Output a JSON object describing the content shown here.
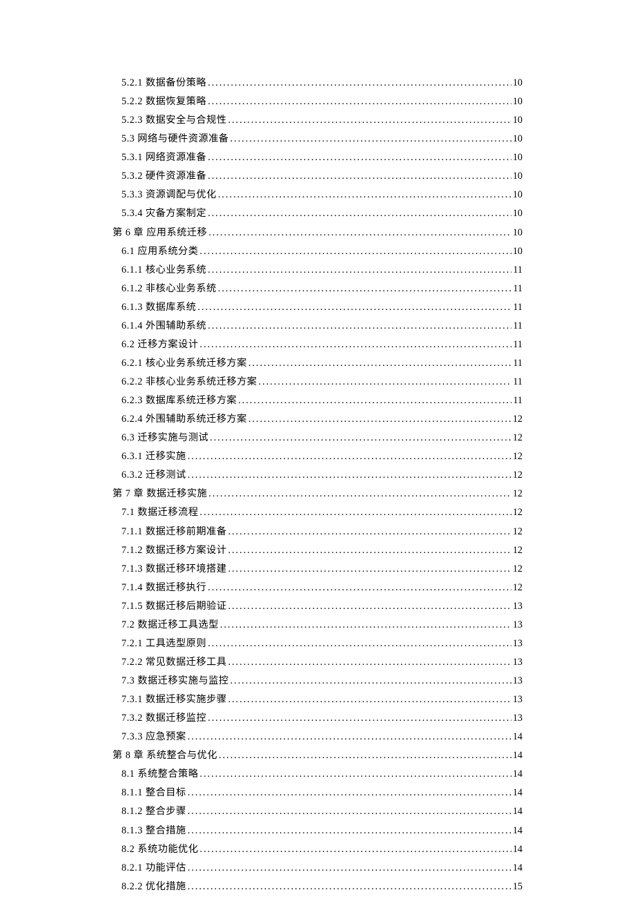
{
  "toc": [
    {
      "level": 1,
      "title": "5.2.1 数据备份策略",
      "page": "10"
    },
    {
      "level": 1,
      "title": "5.2.2 数据恢复策略",
      "page": "10"
    },
    {
      "level": 1,
      "title": "5.2.3 数据安全与合规性",
      "page": "10"
    },
    {
      "level": 1,
      "title": "5.3 网络与硬件资源准备",
      "page": "10"
    },
    {
      "level": 1,
      "title": "5.3.1 网络资源准备",
      "page": "10"
    },
    {
      "level": 1,
      "title": "5.3.2 硬件资源准备",
      "page": "10"
    },
    {
      "level": 1,
      "title": "5.3.3 资源调配与优化",
      "page": "10"
    },
    {
      "level": 1,
      "title": "5.3.4 灾备方案制定",
      "page": "10"
    },
    {
      "level": 0,
      "title": "第 6 章 应用系统迁移",
      "page": "10"
    },
    {
      "level": 1,
      "title": "6.1 应用系统分类",
      "page": "10"
    },
    {
      "level": 1,
      "title": "6.1.1 核心业务系统",
      "page": "11"
    },
    {
      "level": 1,
      "title": "6.1.2 非核心业务系统",
      "page": "11"
    },
    {
      "level": 1,
      "title": "6.1.3 数据库系统",
      "page": "11"
    },
    {
      "level": 1,
      "title": "6.1.4 外围辅助系统",
      "page": "11"
    },
    {
      "level": 1,
      "title": "6.2 迁移方案设计",
      "page": "11"
    },
    {
      "level": 1,
      "title": "6.2.1 核心业务系统迁移方案",
      "page": "11"
    },
    {
      "level": 1,
      "title": "6.2.2 非核心业务系统迁移方案",
      "page": "11"
    },
    {
      "level": 1,
      "title": "6.2.3 数据库系统迁移方案",
      "page": "11"
    },
    {
      "level": 1,
      "title": "6.2.4 外围辅助系统迁移方案",
      "page": "12"
    },
    {
      "level": 1,
      "title": "6.3 迁移实施与测试",
      "page": "12"
    },
    {
      "level": 1,
      "title": "6.3.1 迁移实施",
      "page": "12"
    },
    {
      "level": 1,
      "title": "6.3.2 迁移测试",
      "page": "12"
    },
    {
      "level": 0,
      "title": "第 7 章 数据迁移实施",
      "page": "12"
    },
    {
      "level": 1,
      "title": "7.1 数据迁移流程",
      "page": "12"
    },
    {
      "level": 1,
      "title": "7.1.1 数据迁移前期准备",
      "page": "12"
    },
    {
      "level": 1,
      "title": "7.1.2 数据迁移方案设计",
      "page": "12"
    },
    {
      "level": 1,
      "title": "7.1.3 数据迁移环境搭建",
      "page": "12"
    },
    {
      "level": 1,
      "title": "7.1.4 数据迁移执行",
      "page": "12"
    },
    {
      "level": 1,
      "title": "7.1.5 数据迁移后期验证",
      "page": "13"
    },
    {
      "level": 1,
      "title": "7.2 数据迁移工具选型",
      "page": "13"
    },
    {
      "level": 1,
      "title": "7.2.1 工具选型原则",
      "page": "13"
    },
    {
      "level": 1,
      "title": "7.2.2 常见数据迁移工具",
      "page": "13"
    },
    {
      "level": 1,
      "title": "7.3 数据迁移实施与监控",
      "page": "13"
    },
    {
      "level": 1,
      "title": "7.3.1 数据迁移实施步骤",
      "page": "13"
    },
    {
      "level": 1,
      "title": "7.3.2 数据迁移监控",
      "page": "13"
    },
    {
      "level": 1,
      "title": "7.3.3 应急预案",
      "page": "14"
    },
    {
      "level": 0,
      "title": "第 8 章 系统整合与优化",
      "page": "14"
    },
    {
      "level": 1,
      "title": "8.1 系统整合策略",
      "page": "14"
    },
    {
      "level": 1,
      "title": "8.1.1 整合目标",
      "page": "14"
    },
    {
      "level": 1,
      "title": "8.1.2 整合步骤",
      "page": "14"
    },
    {
      "level": 1,
      "title": "8.1.3 整合措施",
      "page": "14"
    },
    {
      "level": 1,
      "title": "8.2 系统功能优化",
      "page": "14"
    },
    {
      "level": 1,
      "title": "8.2.1 功能评估",
      "page": "14"
    },
    {
      "level": 1,
      "title": "8.2.2 优化措施",
      "page": "15"
    }
  ]
}
